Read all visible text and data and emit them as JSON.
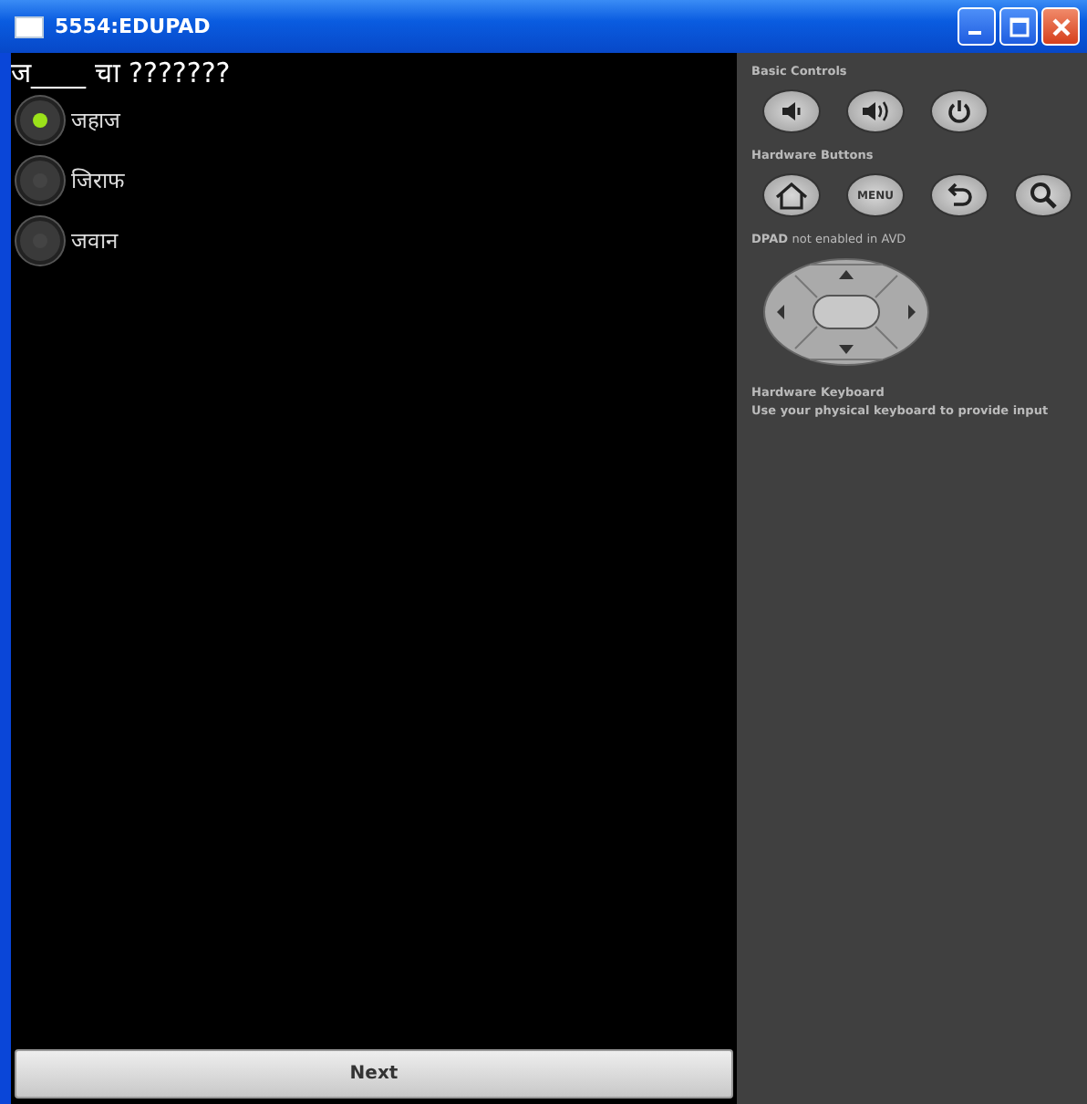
{
  "window": {
    "title": "5554:EDUPAD"
  },
  "question": "ज____ चा ???????",
  "options": [
    {
      "label": "जहाज",
      "selected": true
    },
    {
      "label": "जिराफ",
      "selected": false
    },
    {
      "label": "जवान",
      "selected": false
    }
  ],
  "next_button": "Next",
  "panel": {
    "basic_controls": "Basic Controls",
    "hardware_buttons": "Hardware Buttons",
    "menu_key": "MENU",
    "dpad_title": "DPAD",
    "dpad_note": "not enabled in AVD",
    "keyboard_title": "Hardware Keyboard",
    "keyboard_note": "Use your physical keyboard to provide input"
  }
}
